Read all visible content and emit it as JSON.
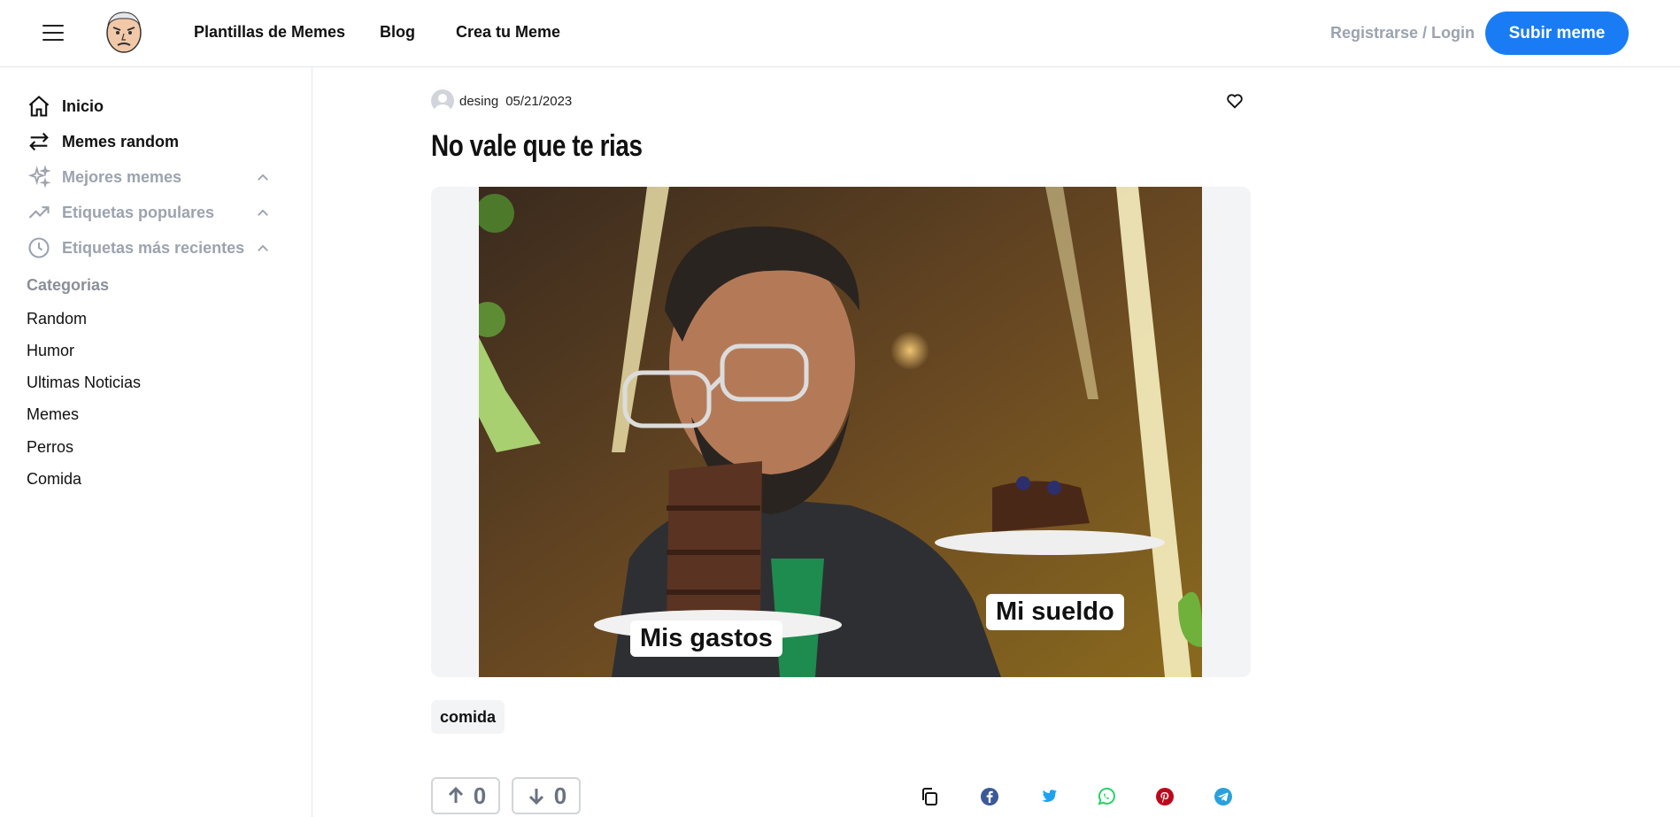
{
  "header": {
    "menu_icon": "hamburger-icon",
    "logo_icon": "meme-face-logo",
    "nav": [
      "Plantillas de Memes",
      "Blog",
      "Crea tu Meme"
    ],
    "login": "Registrarse / Login",
    "upload": "Subir meme"
  },
  "sidebar": {
    "items": [
      {
        "label": "Inicio",
        "icon": "home-icon"
      },
      {
        "label": "Memes random",
        "icon": "swap-arrows-icon"
      },
      {
        "label": "Mejores memes",
        "icon": "sparkles-icon"
      },
      {
        "label": "Etiquetas populares",
        "icon": "trending-icon"
      },
      {
        "label": "Etiquetas más recientes",
        "icon": "clock-icon"
      }
    ],
    "categories_title": "Categorias",
    "categories": [
      "Random",
      "Humor",
      "Ultimas Noticias",
      "Memes",
      "Perros",
      "Comida"
    ]
  },
  "post": {
    "author": "desing",
    "date": "05/21/2023",
    "title": "No vale que te rias",
    "captions": [
      "Mis gastos",
      "Mi sueldo"
    ],
    "tag": "comida",
    "upvotes": "0",
    "downvotes": "0",
    "share_icons": [
      "copy-icon",
      "facebook-icon",
      "twitter-icon",
      "whatsapp-icon",
      "pinterest-icon",
      "telegram-icon"
    ]
  },
  "colors": {
    "accent": "#1a7cf5",
    "facebook": "#3b5998",
    "twitter": "#1da1f2",
    "whatsapp": "#25d366",
    "pinterest": "#bd081c",
    "telegram": "#2aa1da"
  }
}
